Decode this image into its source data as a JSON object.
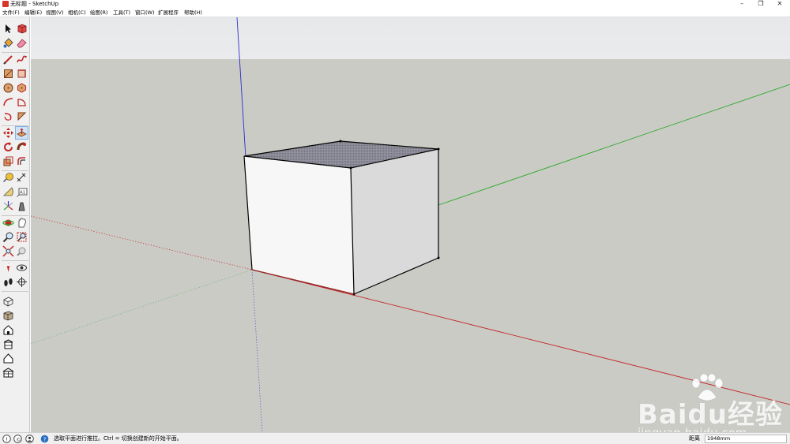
{
  "window": {
    "title": "无标题 - SketchUp",
    "controls": {
      "minimize": "–",
      "maximize": "❐",
      "close": "✕"
    }
  },
  "menu": {
    "items": [
      "文件(F)",
      "编辑(E)",
      "视图(V)",
      "相机(C)",
      "绘图(R)",
      "工具(T)",
      "窗口(W)",
      "扩展程序",
      "帮助(H)"
    ]
  },
  "toolbar": {
    "tools": [
      "select-icon",
      "component-icon",
      "paint-bucket-icon",
      "eraser-icon",
      "line-icon",
      "freehand-icon",
      "rectangle-icon",
      "rotated-rectangle-icon",
      "circle-icon",
      "polygon-icon",
      "arc-icon",
      "pie-icon",
      "two-point-arc-icon",
      "three-point-arc-icon",
      "move-icon",
      "push-pull-icon",
      "rotate-icon",
      "follow-me-icon",
      "scale-icon",
      "offset-icon",
      "tape-measure-icon",
      "dimension-icon",
      "protractor-icon",
      "text-icon",
      "axes-icon",
      "3d-text-icon",
      "orbit-icon",
      "pan-icon",
      "zoom-icon",
      "zoom-window-icon",
      "zoom-extents-icon",
      "previous-view-icon",
      "position-camera-icon",
      "look-around-icon",
      "walk-icon",
      "section-plane-icon",
      "iso-view-icon",
      "top-view-icon",
      "front-view-icon",
      "right-view-icon",
      "back-view-icon",
      "left-view-icon"
    ],
    "active_tool": "push-pull-icon"
  },
  "colors": {
    "sky": "#e3e5e7",
    "ground": "#cbcbc6",
    "axis_red": "#c22727",
    "axis_green": "#2aa82a",
    "axis_blue": "#2c2ccf",
    "face_front": "#f7f7f7",
    "face_right": "#dadada",
    "face_top": "#8a8a96",
    "edge": "#000000"
  },
  "watermark": {
    "brand": "Baidu经验",
    "url": "jingyan.baidu.com"
  },
  "status": {
    "message": "选取平面进行推拉。Ctrl = 切换创建新的开始平面。",
    "icons": [
      "info-icon",
      "credit-icon",
      "user-icon",
      "help-icon"
    ],
    "measurement_label": "距离",
    "measurement_value": "1948mm"
  }
}
